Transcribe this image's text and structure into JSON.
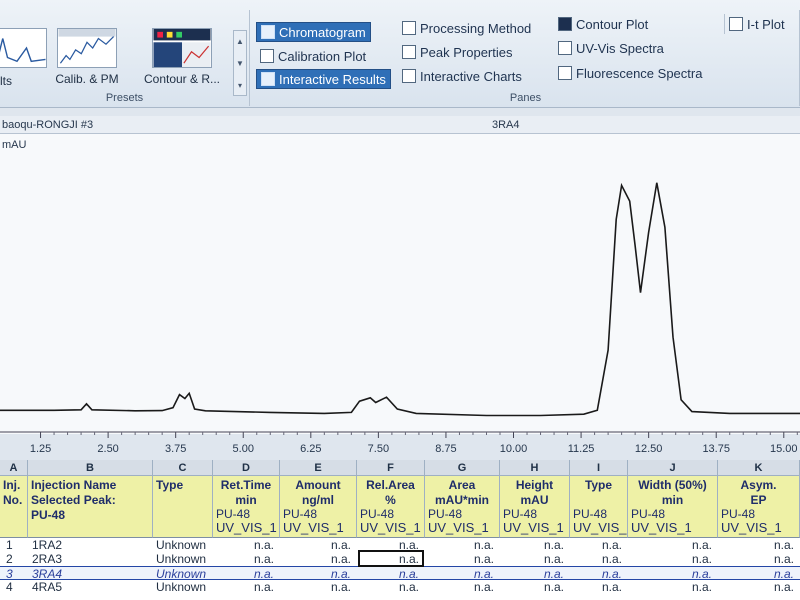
{
  "ribbon": {
    "presets": {
      "label": "Presets",
      "items": [
        {
          "label": "lts"
        },
        {
          "label": "Calib. & PM"
        },
        {
          "label": "Contour & R..."
        }
      ]
    },
    "panes": {
      "label": "Panes",
      "buttons": [
        {
          "label": "Chromatogram",
          "icon": "chromatogram-icon",
          "active": true
        },
        {
          "label": "Calibration Plot",
          "icon": "calibration-icon",
          "active": false
        },
        {
          "label": "Interactive Results",
          "icon": "results-table-icon",
          "active": true
        },
        {
          "label": "Processing Method",
          "icon": "processing-method-icon",
          "active": false
        },
        {
          "label": "Peak Properties",
          "icon": "peak-properties-icon",
          "active": false
        },
        {
          "label": "Interactive Charts",
          "icon": "interactive-charts-icon",
          "active": false
        },
        {
          "label": "Contour Plot",
          "icon": "contour-plot-icon",
          "active": false
        },
        {
          "label": "UV-Vis Spectra",
          "icon": "uv-vis-icon",
          "active": false
        },
        {
          "label": "Fluorescence Spectra",
          "icon": "fluorescence-icon",
          "active": false
        },
        {
          "label": "I-t Plot",
          "icon": "it-plot-icon",
          "active": false
        }
      ]
    }
  },
  "titlebar": {
    "left": "baoqu-RONGJI #3",
    "center": "3RA4"
  },
  "chart_data": {
    "type": "line",
    "ylabel": "mAU",
    "xlim": [
      0.5,
      15.3
    ],
    "xticks": [
      "1.25",
      "2.50",
      "3.75",
      "5.00",
      "6.25",
      "7.50",
      "8.75",
      "10.00",
      "11.25",
      "12.50",
      "13.75",
      "15.00"
    ],
    "xtick_values": [
      1.25,
      2.5,
      3.75,
      5.0,
      6.25,
      7.5,
      8.75,
      10.0,
      11.25,
      12.5,
      13.75,
      15.0
    ],
    "series": [
      {
        "points": [
          [
            0.5,
            2.0
          ],
          [
            1.5,
            2.0
          ],
          [
            2.0,
            2.2
          ],
          [
            2.1,
            4.5
          ],
          [
            2.2,
            2.2
          ],
          [
            3.0,
            1.8
          ],
          [
            3.5,
            1.9
          ],
          [
            3.7,
            3.0
          ],
          [
            3.82,
            8.0
          ],
          [
            3.92,
            6.5
          ],
          [
            4.0,
            8.5
          ],
          [
            4.1,
            2.5
          ],
          [
            4.3,
            1.8
          ],
          [
            5.5,
            1.2
          ],
          [
            6.5,
            0.8
          ],
          [
            7.0,
            1.2
          ],
          [
            7.15,
            5.5
          ],
          [
            7.35,
            6.8
          ],
          [
            7.45,
            5.0
          ],
          [
            7.65,
            7.0
          ],
          [
            7.85,
            2.5
          ],
          [
            8.2,
            0.8
          ],
          [
            9.5,
            0.0
          ],
          [
            10.5,
            0.0
          ],
          [
            11.3,
            0.5
          ],
          [
            11.55,
            2.0
          ],
          [
            11.75,
            25.0
          ],
          [
            11.9,
            75.0
          ],
          [
            12.0,
            88.0
          ],
          [
            12.15,
            82.0
          ],
          [
            12.25,
            65.0
          ],
          [
            12.35,
            47.0
          ],
          [
            12.5,
            70.0
          ],
          [
            12.65,
            89.0
          ],
          [
            12.8,
            72.0
          ],
          [
            12.95,
            30.0
          ],
          [
            13.1,
            6.0
          ],
          [
            13.3,
            1.5
          ],
          [
            14.0,
            0.8
          ],
          [
            15.3,
            0.8
          ]
        ]
      }
    ],
    "ylim": [
      -4,
      100
    ],
    "grid": false
  },
  "table": {
    "column_letters": [
      "A",
      "B",
      "C",
      "D",
      "E",
      "F",
      "G",
      "H",
      "I",
      "J",
      "K"
    ],
    "headers": [
      {
        "lines": [
          "Inj.",
          "No."
        ],
        "sub": []
      },
      {
        "lines": [
          "Injection Name",
          "Selected Peak:",
          "PU-48"
        ],
        "sub": []
      },
      {
        "lines": [
          "Type"
        ],
        "sub": []
      },
      {
        "lines": [
          "Ret.Time",
          "min"
        ],
        "sub": [
          "PU-48",
          "UV_VIS_1"
        ]
      },
      {
        "lines": [
          "Amount",
          "ng/ml"
        ],
        "sub": [
          "PU-48",
          "UV_VIS_1"
        ]
      },
      {
        "lines": [
          "Rel.Area",
          "%"
        ],
        "sub": [
          "PU-48",
          "UV_VIS_1"
        ]
      },
      {
        "lines": [
          "Area",
          "mAU*min"
        ],
        "sub": [
          "PU-48",
          "UV_VIS_1"
        ]
      },
      {
        "lines": [
          "Height",
          "mAU"
        ],
        "sub": [
          "PU-48",
          "UV_VIS_1"
        ]
      },
      {
        "lines": [
          "Type"
        ],
        "sub": [
          "PU-48",
          "UV_VIS_"
        ]
      },
      {
        "lines": [
          "Width (50%)",
          "min"
        ],
        "sub": [
          "PU-48",
          "UV_VIS_1"
        ]
      },
      {
        "lines": [
          "Asym.",
          "EP"
        ],
        "sub": [
          "PU-48",
          "UV_VIS_1"
        ]
      }
    ],
    "rows": [
      {
        "no": "1",
        "name": "1RA2",
        "type": "Unknown",
        "cells": [
          "n.a.",
          "n.a.",
          "n.a.",
          "n.a.",
          "n.a.",
          "n.a.",
          "n.a.",
          "n.a."
        ],
        "highlight": false
      },
      {
        "no": "2",
        "name": "2RA3",
        "type": "Unknown",
        "cells": [
          "n.a.",
          "n.a.",
          "n.a.",
          "n.a.",
          "n.a.",
          "n.a.",
          "n.a.",
          "n.a."
        ],
        "highlight": false
      },
      {
        "no": "3",
        "name": "3RA4",
        "type": "Unknown",
        "cells": [
          "n.a.",
          "n.a.",
          "n.a.",
          "n.a.",
          "n.a.",
          "n.a.",
          "n.a.",
          "n.a."
        ],
        "highlight": true
      },
      {
        "no": "4",
        "name": "4RA5",
        "type": "Unknown",
        "cells": [
          "n.a.",
          "n.a.",
          "n.a.",
          "n.a.",
          "n.a.",
          "n.a.",
          "n.a.",
          "n.a."
        ],
        "highlight": false
      }
    ]
  },
  "colors": {
    "accent": "#2f6fb7",
    "header_fill": "#eef1a6",
    "header_text": "#1f2d6a",
    "trace": "#1a1a1a"
  }
}
